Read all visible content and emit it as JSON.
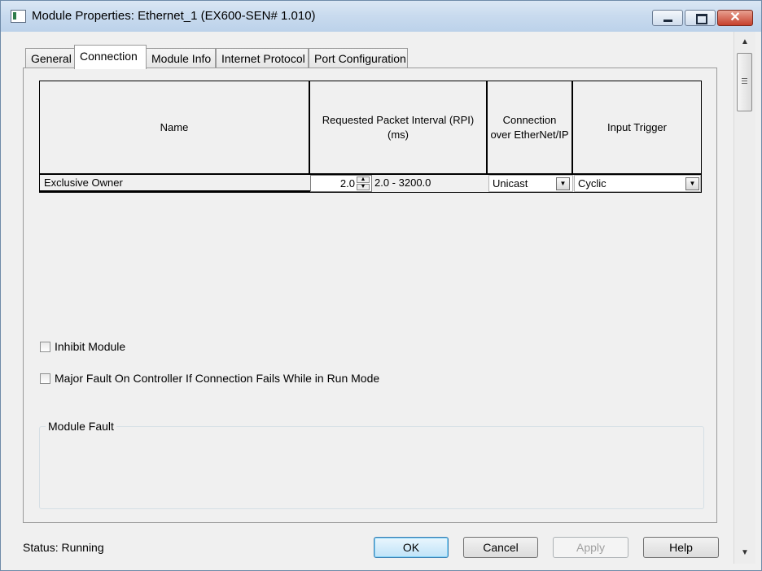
{
  "window": {
    "title": "Module Properties: Ethernet_1 (EX600-SEN# 1.010)",
    "controls": {
      "minimize_icon": "minimize-icon",
      "maximize_icon": "maximize-icon",
      "close_glyph": "✕"
    }
  },
  "tabs": [
    {
      "label": "General",
      "active": false
    },
    {
      "label": "Connection",
      "active": true
    },
    {
      "label": "Module Info",
      "active": false
    },
    {
      "label": "Internet Protocol",
      "active": false
    },
    {
      "label": "Port Configuration",
      "active": false
    }
  ],
  "connection_table": {
    "headers": {
      "name": "Name",
      "rpi_line1": "Requested Packet Interval (RPI)",
      "rpi_line2": "(ms)",
      "conn_line1": "Connection",
      "conn_line2": "over EtherNet/IP",
      "trigger": "Input Trigger"
    },
    "row": {
      "name": "Exclusive Owner",
      "rpi": "2.0",
      "range": "2.0 - 3200.0",
      "connection_type": "Unicast",
      "input_trigger": "Cyclic"
    }
  },
  "options": {
    "inhibit_module": {
      "label": "Inhibit Module",
      "checked": false
    },
    "major_fault": {
      "label": "Major Fault On Controller If Connection Fails While in Run Mode",
      "checked": false
    }
  },
  "module_fault": {
    "label": "Module Fault"
  },
  "status": {
    "text": "Status:  Running"
  },
  "buttons": {
    "ok": "OK",
    "cancel": "Cancel",
    "apply": "Apply",
    "help": "Help"
  },
  "colors": {
    "titlebar": "#c8daee",
    "close": "#c6402c",
    "ok_default_border": "#3c7fb1"
  }
}
